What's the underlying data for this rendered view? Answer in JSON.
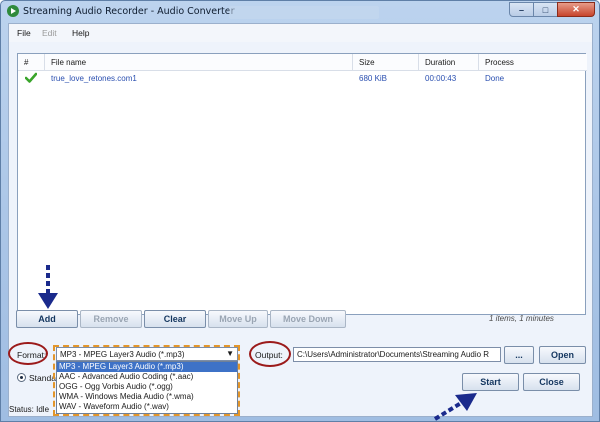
{
  "window": {
    "title": "Streaming Audio Recorder - Audio Converter"
  },
  "titlebar_buttons": {
    "minimize": "–",
    "maximize": "□",
    "close": "✕"
  },
  "menu": {
    "items": [
      {
        "label": "File",
        "disabled": false
      },
      {
        "label": "Edit",
        "disabled": true
      },
      {
        "label": "Help",
        "disabled": false
      }
    ]
  },
  "list": {
    "columns": [
      "#",
      "File name",
      "Size",
      "Duration",
      "Process"
    ],
    "rows": [
      {
        "file_name": "true_love_retones.com1",
        "size": "680 KiB",
        "duration": "00:00:43",
        "process": "Done"
      }
    ]
  },
  "toolbar": {
    "add": "Add",
    "remove": "Remove",
    "clear": "Clear",
    "move_up": "Move Up",
    "move_down": "Move Down"
  },
  "summary": "1 items, 1 minutes",
  "format": {
    "label": "Format:",
    "selected": "MP3 - MPEG Layer3 Audio (*.mp3)",
    "options": [
      "MP3 - MPEG Layer3 Audio (*.mp3)",
      "AAC - Advanced Audio Coding (*.aac)",
      "OGG - Ogg Vorbis Audio (*.ogg)",
      "WMA - Windows Media Audio (*.wma)",
      "WAV - Waveform Audio (*.wav)"
    ]
  },
  "output": {
    "label": "Output:",
    "path": "C:\\Users\\Administrator\\Documents\\Streaming Audio R",
    "browse": "...",
    "open": "Open"
  },
  "quality": {
    "radio_label": "Standa"
  },
  "actions": {
    "start": "Start",
    "close": "Close"
  },
  "status": {
    "text": "Status: Idle"
  },
  "colors": {
    "annotation_arrow": "#1a2a8c",
    "annotation_circle": "#9b1a1a",
    "annotation_dash": "#e3962b",
    "selection": "#3e72c7"
  }
}
